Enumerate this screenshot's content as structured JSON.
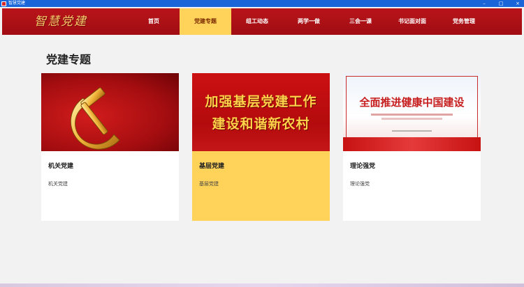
{
  "window": {
    "title": "智慧党建",
    "controls": {
      "minimize": "–",
      "maximize": "□",
      "close": "×"
    }
  },
  "header": {
    "logo": "智慧党建",
    "nav": [
      {
        "label": "首页",
        "active": false
      },
      {
        "label": "党建专题",
        "active": true
      },
      {
        "label": "组工动态",
        "active": false
      },
      {
        "label": "两学一做",
        "active": false
      },
      {
        "label": "三会一课",
        "active": false
      },
      {
        "label": "书记面对面",
        "active": false
      },
      {
        "label": "党务管理",
        "active": false
      }
    ]
  },
  "main": {
    "page_title": "党建专题",
    "cards": [
      {
        "title": "机关党建",
        "subtitle": "机关党建",
        "image": "hammer-sickle-emblem",
        "active": false
      },
      {
        "title": "基层党建",
        "subtitle": "基层党建",
        "image": "banner",
        "banner_line1": "加强基层党建工作",
        "banner_line2": "建设和谐新农村",
        "active": true
      },
      {
        "title": "理论强党",
        "subtitle": "理论强党",
        "image": "poster",
        "poster_headline": "全面推进健康中国建设",
        "active": false
      }
    ]
  },
  "colors": {
    "brand_red": "#b8141a",
    "active_yellow": "#ffd35a",
    "titlebar_blue": "#1a66d8",
    "logo_gold": "#f3c86a"
  }
}
